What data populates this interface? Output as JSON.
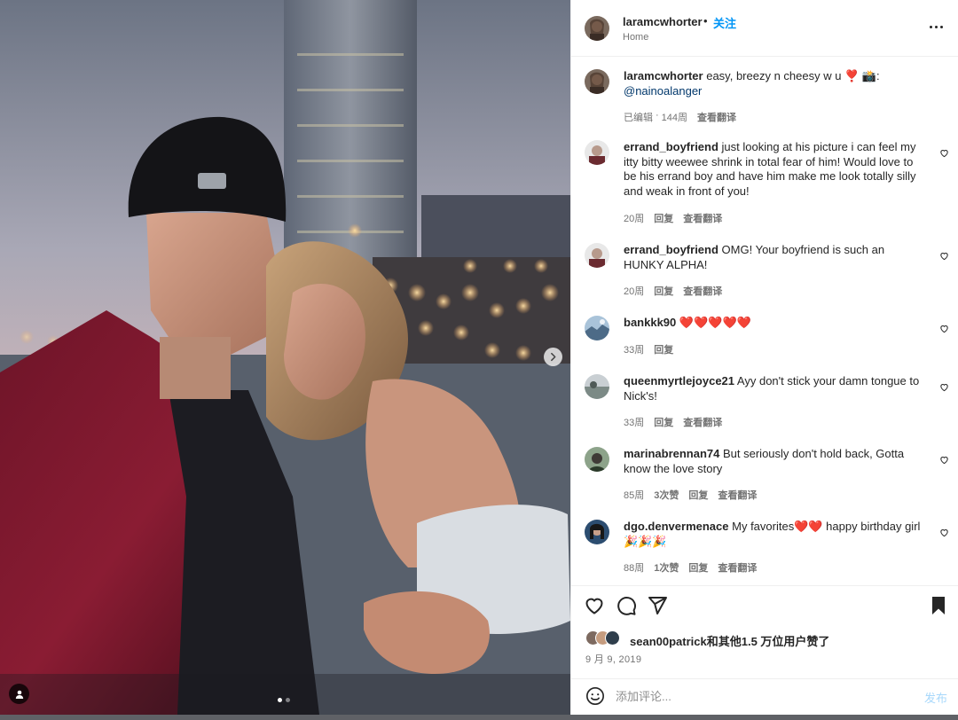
{
  "post": {
    "username": "laramcwhorter",
    "separator": "•",
    "follow_label": "关注",
    "location": "Home",
    "more_icon": "more-horizontal-icon"
  },
  "caption": {
    "username": "laramcwhorter",
    "text": "easy, breezy n cheesy w u ❣️ 📸:",
    "mention": "@nainoalanger",
    "edited": "已编辑",
    "dot": "·",
    "time": "144周",
    "translate": "查看翻译"
  },
  "comments": [
    {
      "username": "errand_boyfriend",
      "text": "just looking at his picture i can feel my itty bitty weewee shrink in total fear of him! Would love to be his errand boy and have him make me look totally silly and weak in front of you!",
      "time": "20周",
      "reply": "回复",
      "translate": "查看翻译",
      "avatar_color": "#9aa0a8"
    },
    {
      "username": "errand_boyfriend",
      "text": "OMG! Your boyfriend is such an HUNKY ALPHA!",
      "time": "20周",
      "reply": "回复",
      "translate": "查看翻译",
      "avatar_color": "#9aa0a8"
    },
    {
      "username": "bankkk90",
      "text": "❤️❤️❤️❤️❤️",
      "time": "33周",
      "reply": "回复",
      "avatar_color": "#6f93b8"
    },
    {
      "username": "queenmyrtlejoyce21",
      "text": "Ayy don't stick your damn tongue to Nick's!",
      "time": "33周",
      "reply": "回复",
      "translate": "查看翻译",
      "avatar_color": "#7f8a86"
    },
    {
      "username": "marinabrennan74",
      "text": "But seriously don't hold back, Gotta know the love story",
      "time": "85周",
      "likes": "3次赞",
      "reply": "回复",
      "translate": "查看翻译",
      "avatar_color": "#5d6e5a"
    },
    {
      "username": "dgo.denvermenace",
      "text": "My favorites❤️❤️ happy birthday girl🎉🎉🎉",
      "time": "88周",
      "likes": "1次赞",
      "reply": "回复",
      "translate": "查看翻译",
      "avatar_color": "#2c4d70"
    }
  ],
  "actions": {
    "like_icon": "heart-outline-icon",
    "comment_icon": "comment-bubble-icon",
    "share_icon": "paper-plane-icon",
    "save_icon": "bookmark-filled-icon"
  },
  "likes": {
    "text": "sean00patrick和其他1.5 万位用户赞了"
  },
  "date": "9 月 9, 2019",
  "add_comment": {
    "placeholder": "添加评论...",
    "post_label": "发布",
    "emoji_icon": "smiley-icon"
  },
  "carousel": {
    "current_slide": 1,
    "total_slides": 2
  },
  "colors": {
    "accent": "#0095f6",
    "mention": "#00376b",
    "meta": "#737373",
    "heart": "#e0182d"
  }
}
